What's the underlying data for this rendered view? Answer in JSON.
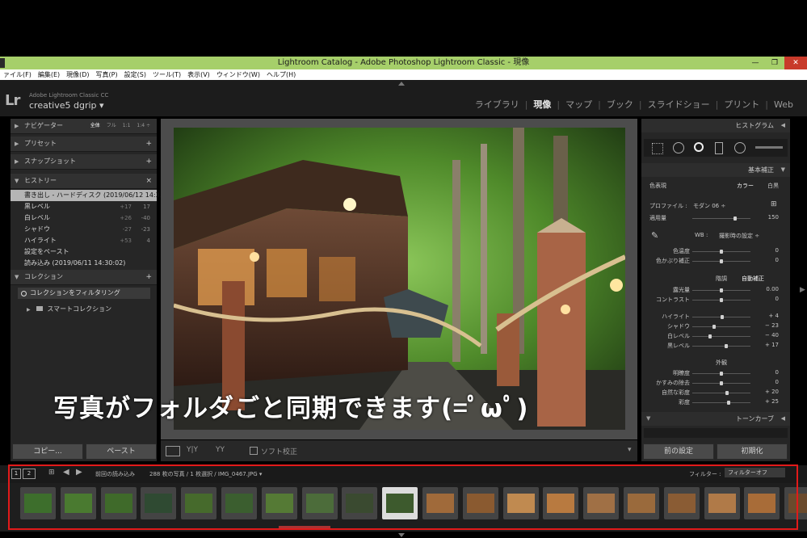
{
  "window": {
    "title": "Lightroom Catalog - Adobe Photoshop Lightroom Classic - 現像",
    "buttons": [
      "—",
      "❐",
      "✕"
    ]
  },
  "menu": [
    "ァイル(F)",
    "編集(E)",
    "現像(D)",
    "写真(P)",
    "設定(S)",
    "ツール(T)",
    "表示(V)",
    "ウィンドウ(W)",
    "ヘルプ(H)"
  ],
  "identity": {
    "logo": "Lr",
    "product": "Adobe Lightroom Classic CC",
    "user": "creative5 dgrip ▾"
  },
  "modules": [
    "ライブラリ",
    "現像",
    "マップ",
    "ブック",
    "スライドショー",
    "プリント",
    "Web"
  ],
  "active_module": "現像",
  "left_panel": {
    "navigator": {
      "label": "ナビゲーター",
      "options": [
        "全体",
        "フル",
        "1:1",
        "1:4 ÷"
      ]
    },
    "presets": {
      "label": "プリセット",
      "action": "+"
    },
    "snapshots": {
      "label": "スナップショット",
      "action": "+"
    },
    "history": {
      "label": "ヒストリー",
      "action": "×",
      "items": [
        {
          "name": "書き出し - ハードディスク (2019/06/12 14:3...",
          "v1": "",
          "v2": ""
        },
        {
          "name": "黒レベル",
          "v1": "+17",
          "v2": "17"
        },
        {
          "name": "白レベル",
          "v1": "+26",
          "v2": "-40"
        },
        {
          "name": "シャドウ",
          "v1": "-27",
          "v2": "-23"
        },
        {
          "name": "ハイライト",
          "v1": "+53",
          "v2": "4"
        },
        {
          "name": "設定をペースト",
          "v1": "",
          "v2": ""
        },
        {
          "name": "読み込み (2019/06/11 14:30:02)",
          "v1": "",
          "v2": ""
        }
      ]
    },
    "collections": {
      "label": "コレクション",
      "action": "+",
      "filter": "コレクションをフィルタリング",
      "smart": "スマートコレクション"
    },
    "copy_button": "コピー...",
    "paste_button": "ペースト"
  },
  "toolbar": {
    "soft_proof": "ソフト校正",
    "view1": "Y|Y",
    "view2": "YY"
  },
  "right_panel": {
    "histogram": "ヒストグラム",
    "basic": "基本補正",
    "treatment_label": "色表現",
    "color": "カラー",
    "bw": "白黒",
    "profile_label": "プロファイル :",
    "profile_value": "モダン 06 ÷",
    "amount_label": "適用量",
    "amount_value": "150",
    "wb_label": "WB :",
    "wb_value": "撮影時の設定 ÷",
    "wb_sliders": [
      {
        "label": "色温度",
        "value": "0",
        "pos": 0.5
      },
      {
        "label": "色かぶり補正",
        "value": "0",
        "pos": 0.5
      }
    ],
    "tone_label": "階調",
    "auto": "自動補正",
    "tone_sliders": [
      {
        "label": "露光量",
        "value": "0.00",
        "pos": 0.5
      },
      {
        "label": "コントラスト",
        "value": "0",
        "pos": 0.5
      }
    ],
    "tone_sliders2": [
      {
        "label": "ハイライト",
        "value": "+ 4",
        "pos": 0.52
      },
      {
        "label": "シャドウ",
        "value": "− 23",
        "pos": 0.38
      },
      {
        "label": "白レベル",
        "value": "− 40",
        "pos": 0.3
      },
      {
        "label": "黒レベル",
        "value": "+ 17",
        "pos": 0.58
      }
    ],
    "presence_label": "外観",
    "presence_sliders": [
      {
        "label": "明瞭度",
        "value": "0",
        "pos": 0.5
      },
      {
        "label": "かすみの除去",
        "value": "0",
        "pos": 0.5
      },
      {
        "label": "自然な彩度",
        "value": "+ 20",
        "pos": 0.6
      },
      {
        "label": "彩度",
        "value": "+ 25",
        "pos": 0.62
      }
    ],
    "tone_curve": "トーンカーブ",
    "prev_button": "前の設定",
    "reset_button": "初期化"
  },
  "filmstrip_bar": {
    "page1": "1",
    "page2": "2",
    "source": "前回の読み込み",
    "info": "288 枚の写真 / 1 枚選択 / IMG_0467.JPG ▾",
    "filter_label": "フィルター :",
    "filter_value": "フィルターオフ"
  },
  "thumbnails": [
    {
      "color": "#3d6e2c"
    },
    {
      "color": "#4a7a30"
    },
    {
      "color": "#3f6a2a"
    },
    {
      "color": "#2f4a32"
    },
    {
      "color": "#466a2c"
    },
    {
      "color": "#3b5e2f"
    },
    {
      "color": "#557a35"
    },
    {
      "color": "#4c6c3a"
    },
    {
      "color": "#3a4a30"
    },
    {
      "color": "#3d5a2d"
    },
    {
      "color": "#a06a3a"
    },
    {
      "color": "#8a5a30"
    },
    {
      "color": "#c08a50"
    },
    {
      "color": "#b87a40"
    },
    {
      "color": "#a07045"
    },
    {
      "color": "#9a6a3c"
    },
    {
      "color": "#8a5c34"
    },
    {
      "color": "#b07a48"
    },
    {
      "color": "#a86c38"
    },
    {
      "color": "#6a4a2c"
    }
  ],
  "selected_thumb": 9,
  "overlay_text": "写真がフォルダごと同期できます(=ﾟωﾟ)"
}
